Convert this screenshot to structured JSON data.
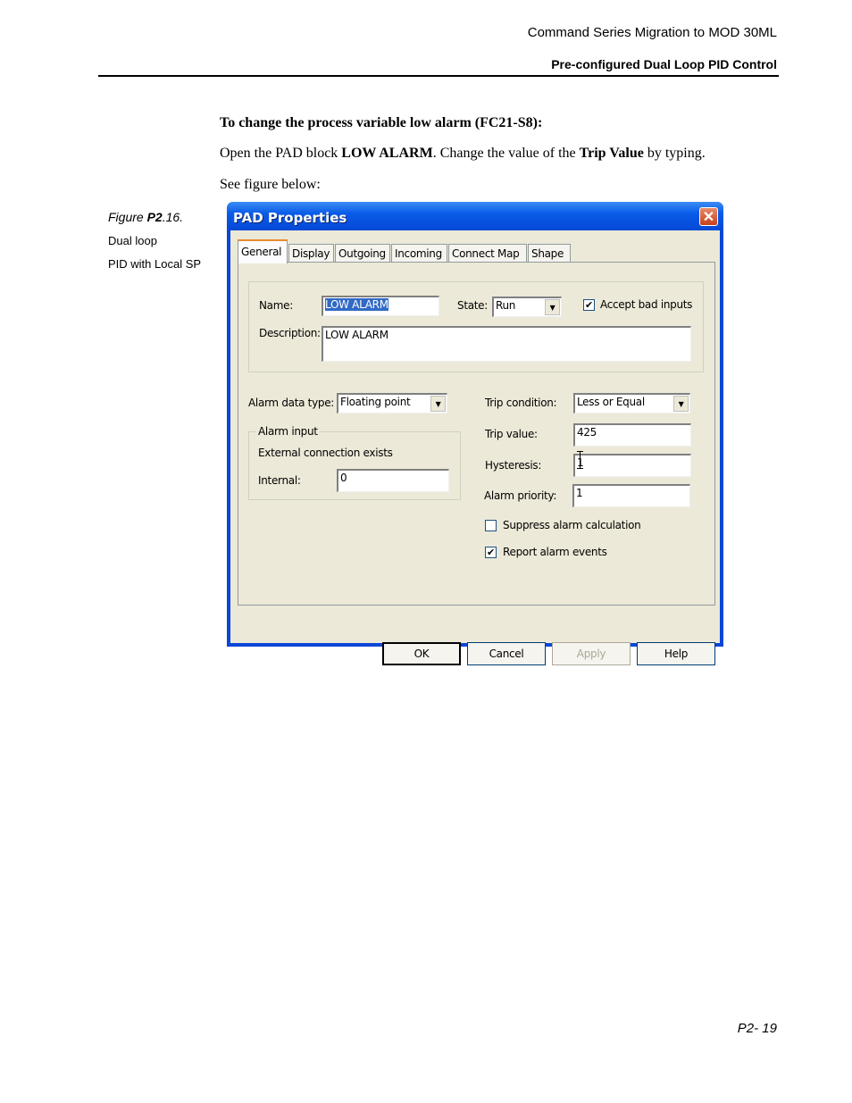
{
  "page": {
    "header_title": "Command Series Migration to MOD 30ML",
    "header_subtitle": "Pre-configured Dual Loop PID Control",
    "instruction_heading": "To change the process variable low alarm (FC21-S8):",
    "instruction_parts": [
      "Open the PAD block ",
      "LOW ALARM",
      ". Change the value of the ",
      "Trip Value",
      " by typing."
    ],
    "see_figure": "See figure below:",
    "figure_caption": {
      "prefix": "Figure ",
      "number_bold": "P2",
      "suffix": ".16.",
      "line2": "Dual loop",
      "line3": "PID with Local SP"
    },
    "page_number": "P2- 19"
  },
  "dialog": {
    "title": "PAD Properties",
    "close_glyph": "✕",
    "tabs": [
      {
        "label": "General",
        "selected": true
      },
      {
        "label": "Display",
        "selected": false
      },
      {
        "label": "Outgoing",
        "selected": false
      },
      {
        "label": "Incoming",
        "selected": false
      },
      {
        "label": "Connect Map",
        "selected": false
      },
      {
        "label": "Shape",
        "selected": false
      }
    ],
    "general": {
      "name_label": "Name:",
      "name_value": "LOW ALARM",
      "state_label": "State:",
      "state_value": "Run",
      "accept_bad_inputs_label": "Accept bad inputs",
      "accept_bad_inputs_checked": true,
      "description_label": "Description:",
      "description_value": "LOW  ALARM",
      "alarm_data_type_label": "Alarm data type:",
      "alarm_data_type_value": "Floating point",
      "alarm_input_group": "Alarm input",
      "external_connection_text": "External connection exists",
      "internal_label": "Internal:",
      "internal_value": "0",
      "trip_condition_label": "Trip condition:",
      "trip_condition_value": "Less or Equal",
      "trip_value_label": "Trip value:",
      "trip_value": "425",
      "hysteresis_label": "Hysteresis:",
      "hysteresis_value": "1",
      "alarm_priority_label": "Alarm priority:",
      "alarm_priority_value": "1",
      "suppress_label": "Suppress alarm calculation",
      "suppress_checked": false,
      "report_label": "Report alarm events",
      "report_checked": true
    },
    "buttons": {
      "ok": "OK",
      "cancel": "Cancel",
      "apply": "Apply",
      "help": "Help"
    },
    "check_glyph": "✔",
    "dropdown_glyph": "▼"
  }
}
